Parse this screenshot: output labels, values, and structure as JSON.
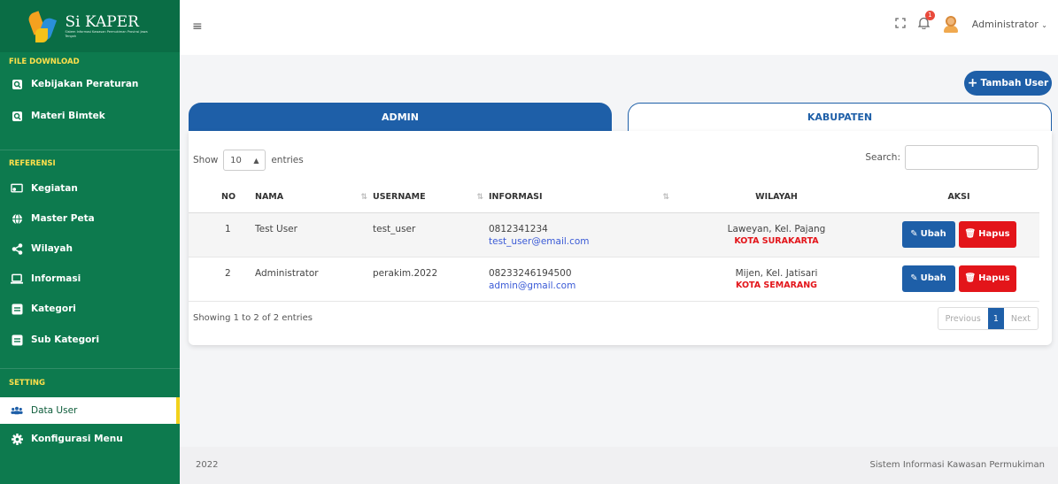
{
  "brand": {
    "title": "Si KAPER",
    "subtitle": "Sistem Informasi Kawasan Permukiman Provinsi Jawa Tengah"
  },
  "sidebar": {
    "sections": [
      {
        "label": "FILE DOWNLOAD"
      },
      {
        "label": "REFERENSI"
      },
      {
        "label": "SETTING"
      }
    ],
    "items": [
      {
        "label": "Kebijakan Peraturan",
        "icon": "file-search-icon"
      },
      {
        "label": "Materi Bimtek",
        "icon": "file-search-icon"
      },
      {
        "label": "Kegiatan",
        "icon": "presentation-icon"
      },
      {
        "label": "Master Peta",
        "icon": "globe-icon"
      },
      {
        "label": "Wilayah",
        "icon": "share-icon"
      },
      {
        "label": "Informasi",
        "icon": "laptop-icon"
      },
      {
        "label": "Kategori",
        "icon": "list-icon"
      },
      {
        "label": "Sub Kategori",
        "icon": "list-icon"
      },
      {
        "label": "Data User",
        "icon": "users-icon"
      },
      {
        "label": "Konfigurasi Menu",
        "icon": "gear-icon"
      }
    ]
  },
  "header": {
    "user_name": "Administrator",
    "notif_count": "1"
  },
  "main": {
    "add_button": "Tambah User",
    "tabs": [
      {
        "label": "ADMIN"
      },
      {
        "label": "KABUPATEN"
      }
    ],
    "show_label": "Show",
    "entries_label": "entries",
    "page_size": "10",
    "search_label": "Search:",
    "columns": [
      "NO",
      "NAMA",
      "USERNAME",
      "INFORMASI",
      "WILAYAH",
      "AKSI"
    ],
    "rows": [
      {
        "no": "1",
        "nama": "Test User",
        "username": "test_user",
        "phone": "0812341234",
        "email": "test_user@email.com",
        "wilayah": "Laweyan, Kel. Pajang",
        "kota": "KOTA SURAKARTA"
      },
      {
        "no": "2",
        "nama": "Administrator",
        "username": "perakim.2022",
        "phone": "08233246194500",
        "email": "admin@gmail.com",
        "wilayah": "Mijen, Kel. Jatisari",
        "kota": "KOTA SEMARANG"
      }
    ],
    "edit_label": "Ubah",
    "delete_label": "Hapus",
    "info": "Showing 1 to 2 of 2 entries",
    "pager": {
      "prev": "Previous",
      "current": "1",
      "next": "Next"
    }
  },
  "footer": {
    "year": "2022",
    "app_name": "Sistem Informasi Kawasan Permukiman"
  },
  "colors": {
    "sidebar": "#0d7a4e",
    "primary": "#1e5fa8",
    "danger": "#e3151a",
    "section": "#ffe04b"
  }
}
